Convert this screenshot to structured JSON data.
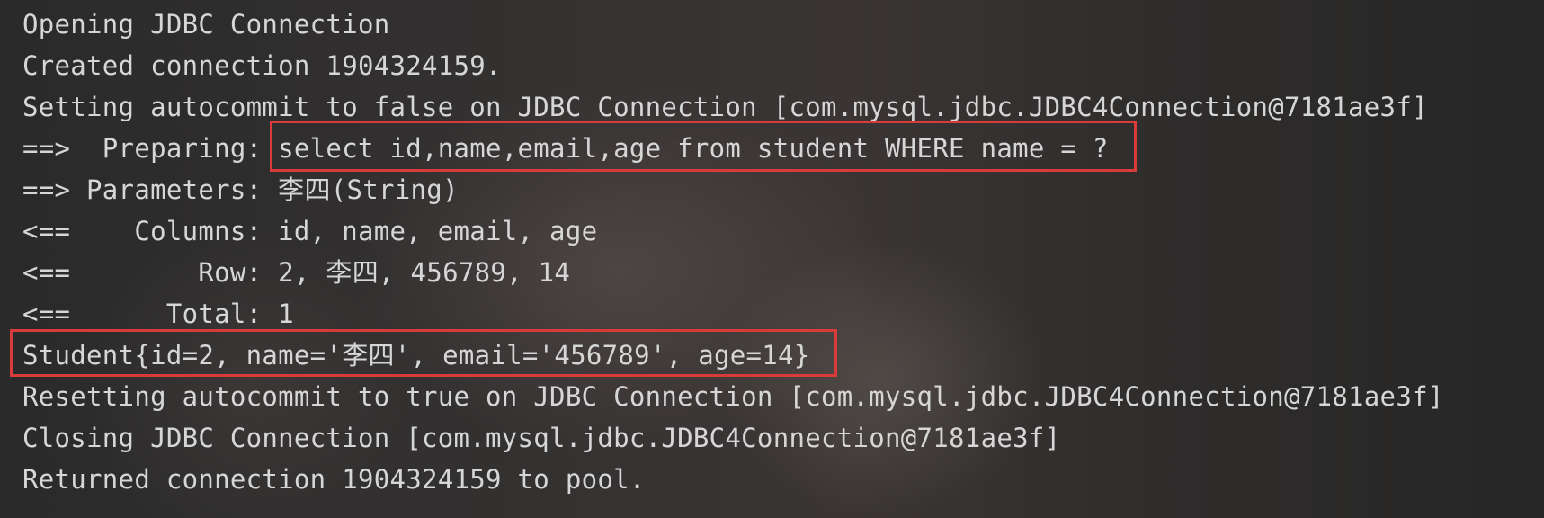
{
  "console": {
    "lines": [
      "Opening JDBC Connection",
      "Created connection 1904324159.",
      "Setting autocommit to false on JDBC Connection [com.mysql.jdbc.JDBC4Connection@7181ae3f]",
      "==>  Preparing: select id,name,email,age from student WHERE name = ? ",
      "==> Parameters: 李四(String)",
      "<==    Columns: id, name, email, age",
      "<==        Row: 2, 李四, 456789, 14",
      "<==      Total: 1",
      "Student{id=2, name='李四', email='456789', age=14}",
      "Resetting autocommit to true on JDBC Connection [com.mysql.jdbc.JDBC4Connection@7181ae3f]",
      "Closing JDBC Connection [com.mysql.jdbc.JDBC4Connection@7181ae3f]",
      "Returned connection 1904324159 to pool."
    ]
  },
  "highlight_color": "#d93a3a",
  "text_color": "#d6d6d6",
  "background_color": "#2b2b2b"
}
